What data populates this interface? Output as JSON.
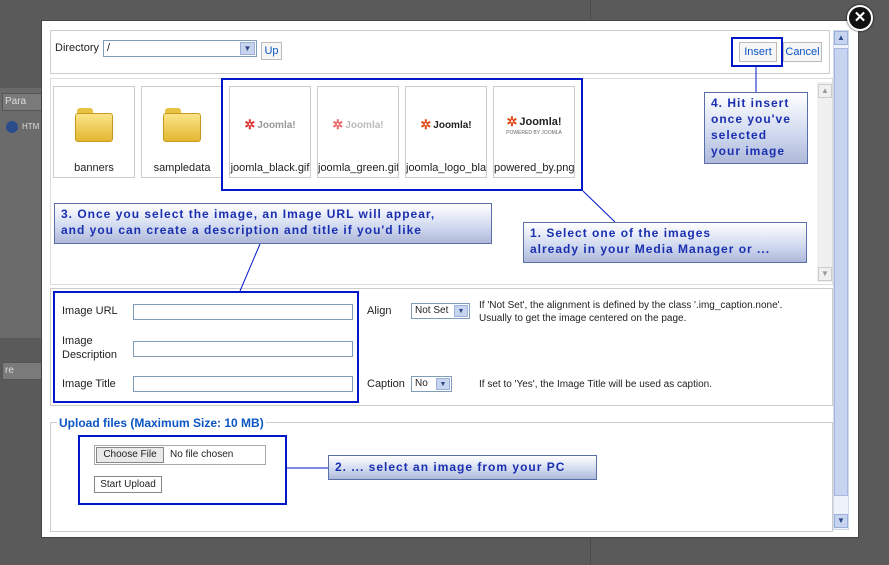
{
  "background": {
    "para_text": "Para",
    "re_text": "re",
    "html_text": "HTM"
  },
  "toolbar": {
    "directory_label": "Directory",
    "directory_value": "/",
    "up_label": "Up",
    "insert_label": "Insert",
    "cancel_label": "Cancel"
  },
  "images": [
    {
      "label": "banners",
      "type": "folder"
    },
    {
      "label": "sampledata",
      "type": "folder"
    },
    {
      "label": "joomla_black.gif",
      "type": "image",
      "logo": "Joomla!"
    },
    {
      "label": "joomla_green.gif",
      "type": "image",
      "logo": "Joomla!"
    },
    {
      "label": "joomla_logo_black",
      "type": "image",
      "logo": "Joomla!"
    },
    {
      "label": "powered_by.png",
      "type": "image",
      "logo": "Joomla!",
      "sub": "POWERED BY JOOMLA"
    }
  ],
  "form": {
    "image_url_label": "Image URL",
    "image_description_label_1": "Image",
    "image_description_label_2": "Description",
    "image_title_label": "Image Title",
    "align_label": "Align",
    "align_value": "Not Set",
    "align_note_1": "If 'Not Set', the alignment is defined by the class '.img_caption.none'.",
    "align_note_2": "Usually to get the image centered on the page.",
    "caption_label": "Caption",
    "caption_value": "No",
    "caption_note": "If set to 'Yes', the Image Title will be used as caption."
  },
  "upload": {
    "legend": "Upload files (Maximum Size: 10 MB)",
    "choose_label": "Choose File",
    "no_file_text": "No file chosen",
    "start_label": "Start Upload"
  },
  "callouts": {
    "step1_line1": "1.  Select one of the images",
    "step1_line2": "already in your Media Manager or ...",
    "step2": "2. ... select an image from your PC",
    "step3_line1": "3.  Once you select the image, an Image URL will appear,",
    "step3_line2": "and you can create a description and title if you'd like",
    "step4_line1": "4.  Hit insert",
    "step4_line2": "once you've",
    "step4_line3": "selected",
    "step4_line4": "your image"
  },
  "colors": {
    "accent": "#0b55c4",
    "highlight": "#0018c8",
    "callout_text": "#1a2fb0"
  }
}
